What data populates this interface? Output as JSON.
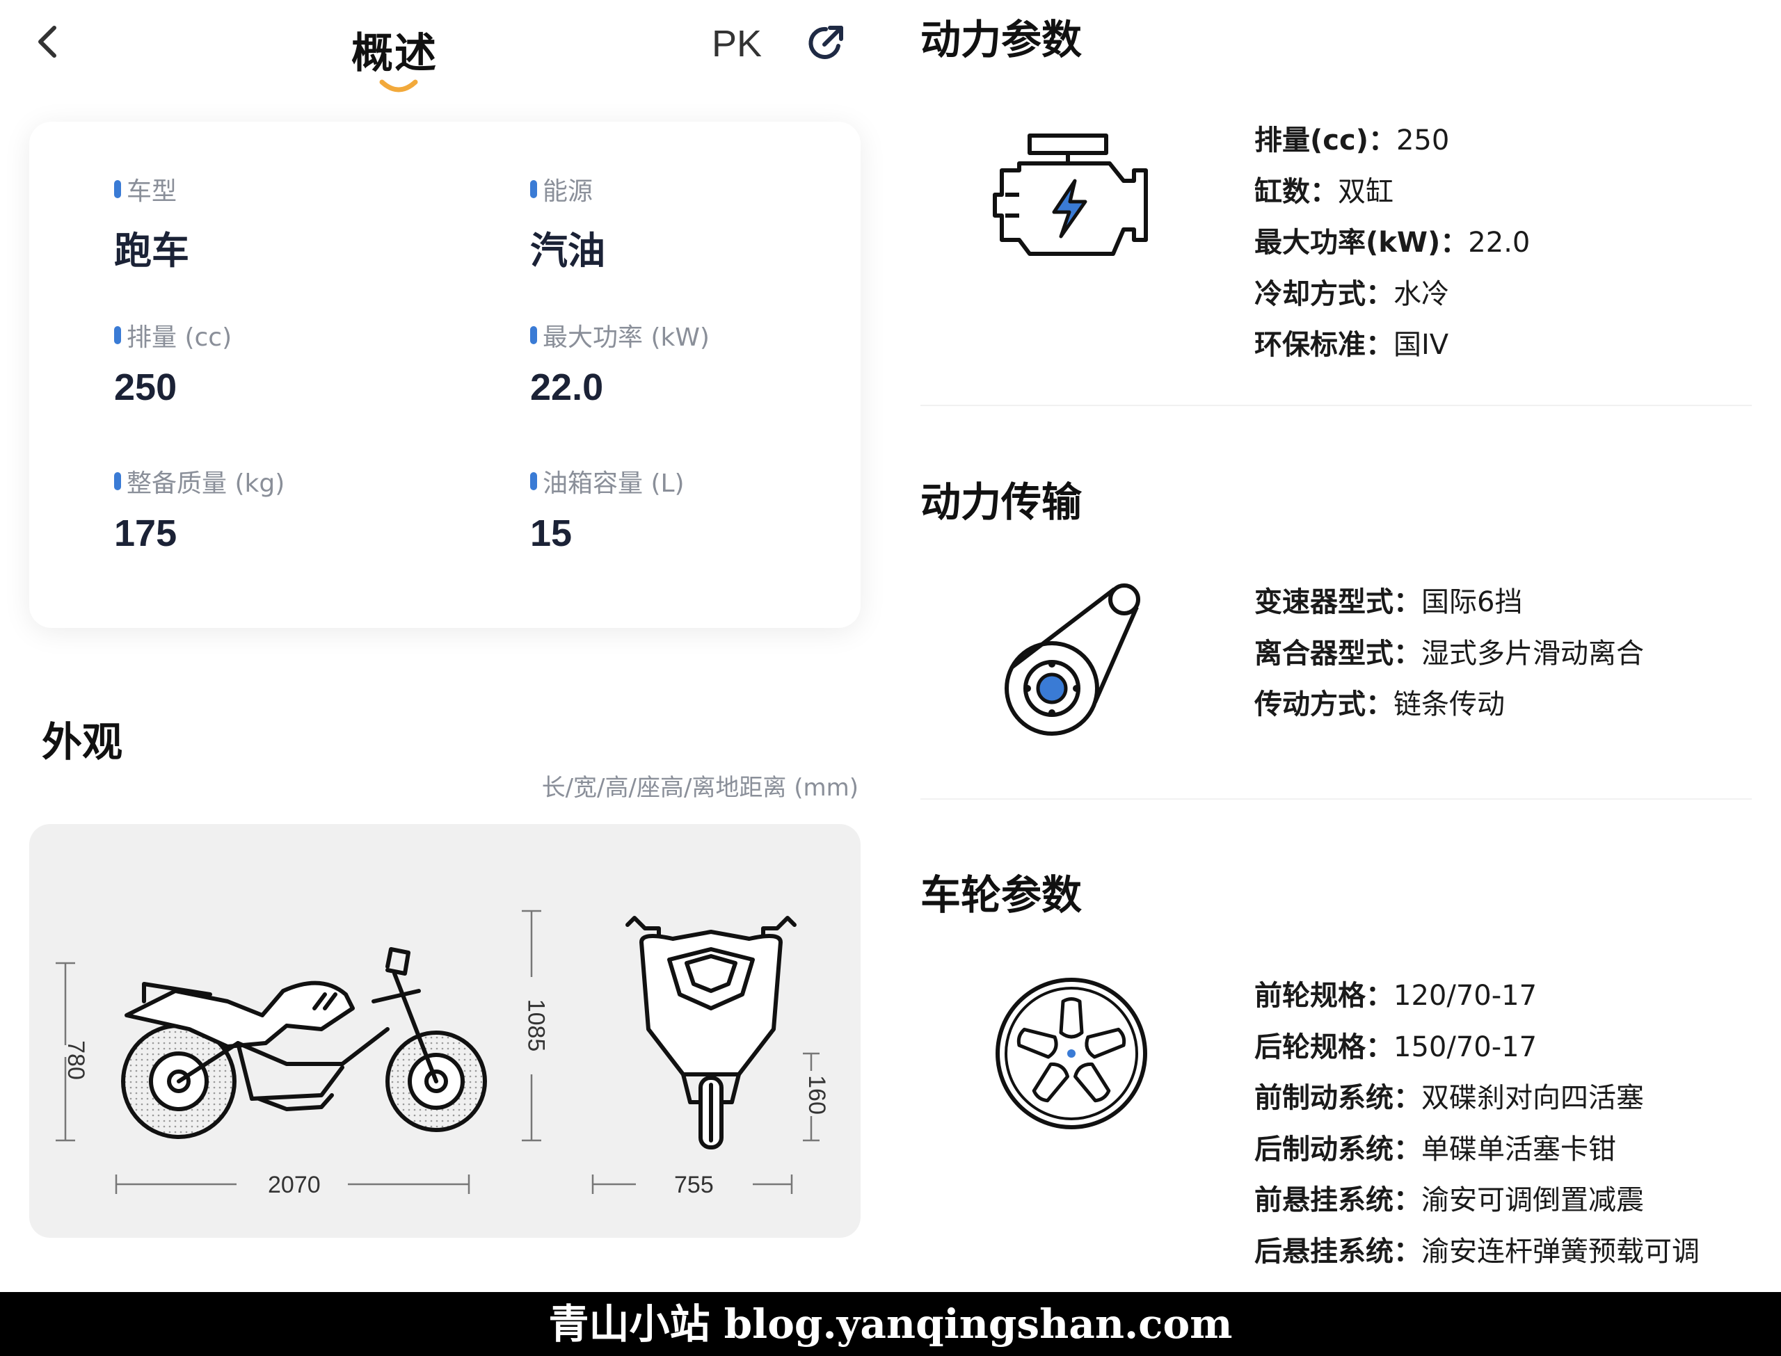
{
  "header": {
    "tab_label": "概述",
    "pk_label": "PK"
  },
  "summary": {
    "items": [
      {
        "label": "车型",
        "value": "跑车"
      },
      {
        "label": "能源",
        "value": "汽油"
      },
      {
        "label": "排量 (cc)",
        "value": "250"
      },
      {
        "label": "最大功率 (kW)",
        "value": "22.0"
      },
      {
        "label": "整备质量 (kg)",
        "value": "175"
      },
      {
        "label": "油箱容量 (L)",
        "value": "15"
      }
    ]
  },
  "appearance": {
    "title": "外观",
    "note": "长/宽/高/座高/离地距离 (mm)",
    "length": "2070",
    "width": "755",
    "height": "1085",
    "seat_height": "780",
    "ground_clearance": "160"
  },
  "sections": [
    {
      "title": "动力参数",
      "params": [
        {
          "k": "排量(cc)：",
          "v": "250"
        },
        {
          "k": "缸数：",
          "v": "双缸"
        },
        {
          "k": "最大功率(kW)：",
          "v": "22.0"
        },
        {
          "k": "冷却方式：",
          "v": "水冷"
        },
        {
          "k": "环保标准：",
          "v": "国IV"
        }
      ]
    },
    {
      "title": "动力传输",
      "params": [
        {
          "k": "变速器型式：",
          "v": "国际6挡"
        },
        {
          "k": "离合器型式：",
          "v": "湿式多片滑动离合"
        },
        {
          "k": "传动方式：",
          "v": "链条传动"
        }
      ]
    },
    {
      "title": "车轮参数",
      "params": [
        {
          "k": "前轮规格：",
          "v": "120/70-17"
        },
        {
          "k": "后轮规格：",
          "v": "150/70-17"
        },
        {
          "k": "前制动系统：",
          "v": "双碟刹对向四活塞"
        },
        {
          "k": "后制动系统：",
          "v": "单碟单活塞卡钳"
        },
        {
          "k": "前悬挂系统：",
          "v": "渝安可调倒置减震"
        },
        {
          "k": "后悬挂系统：",
          "v": "渝安连杆弹簧预载可调"
        }
      ]
    }
  ],
  "footer": {
    "watermark": "青山小站 blog.yanqingshan.com"
  },
  "colors": {
    "accent_blue": "#3a7bd5",
    "tab_underline": "#f2a93b",
    "footer_bg": "#000000"
  }
}
